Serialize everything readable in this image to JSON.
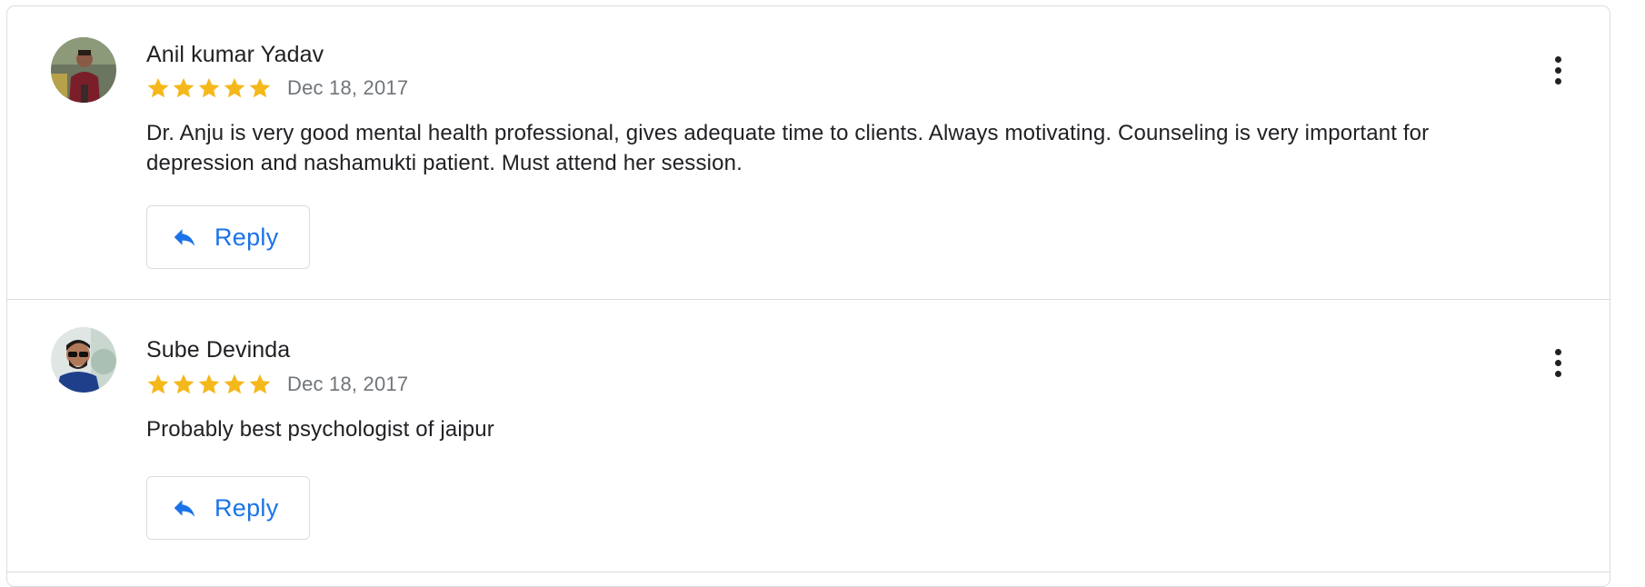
{
  "reviews": [
    {
      "name": "Anil kumar Yadav",
      "rating": 5,
      "date": "Dec 18, 2017",
      "text": "Dr. Anju is very good mental health professional, gives adequate time to clients. Always motivating. Counseling is very important for depression and nashamukti patient. Must attend her session.",
      "reply_label": "Reply"
    },
    {
      "name": "Sube Devinda",
      "rating": 5,
      "date": "Dec 18, 2017",
      "text": "Probably best psychologist of jaipur",
      "reply_label": "Reply"
    }
  ],
  "colors": {
    "star": "#f5b81b",
    "reply_text": "#1a73e8",
    "divider": "#dadce0",
    "date_text": "#70757a"
  },
  "icons": {
    "rating": "star-icon",
    "reply": "reply-arrow-icon",
    "more": "more-vertical-icon"
  }
}
